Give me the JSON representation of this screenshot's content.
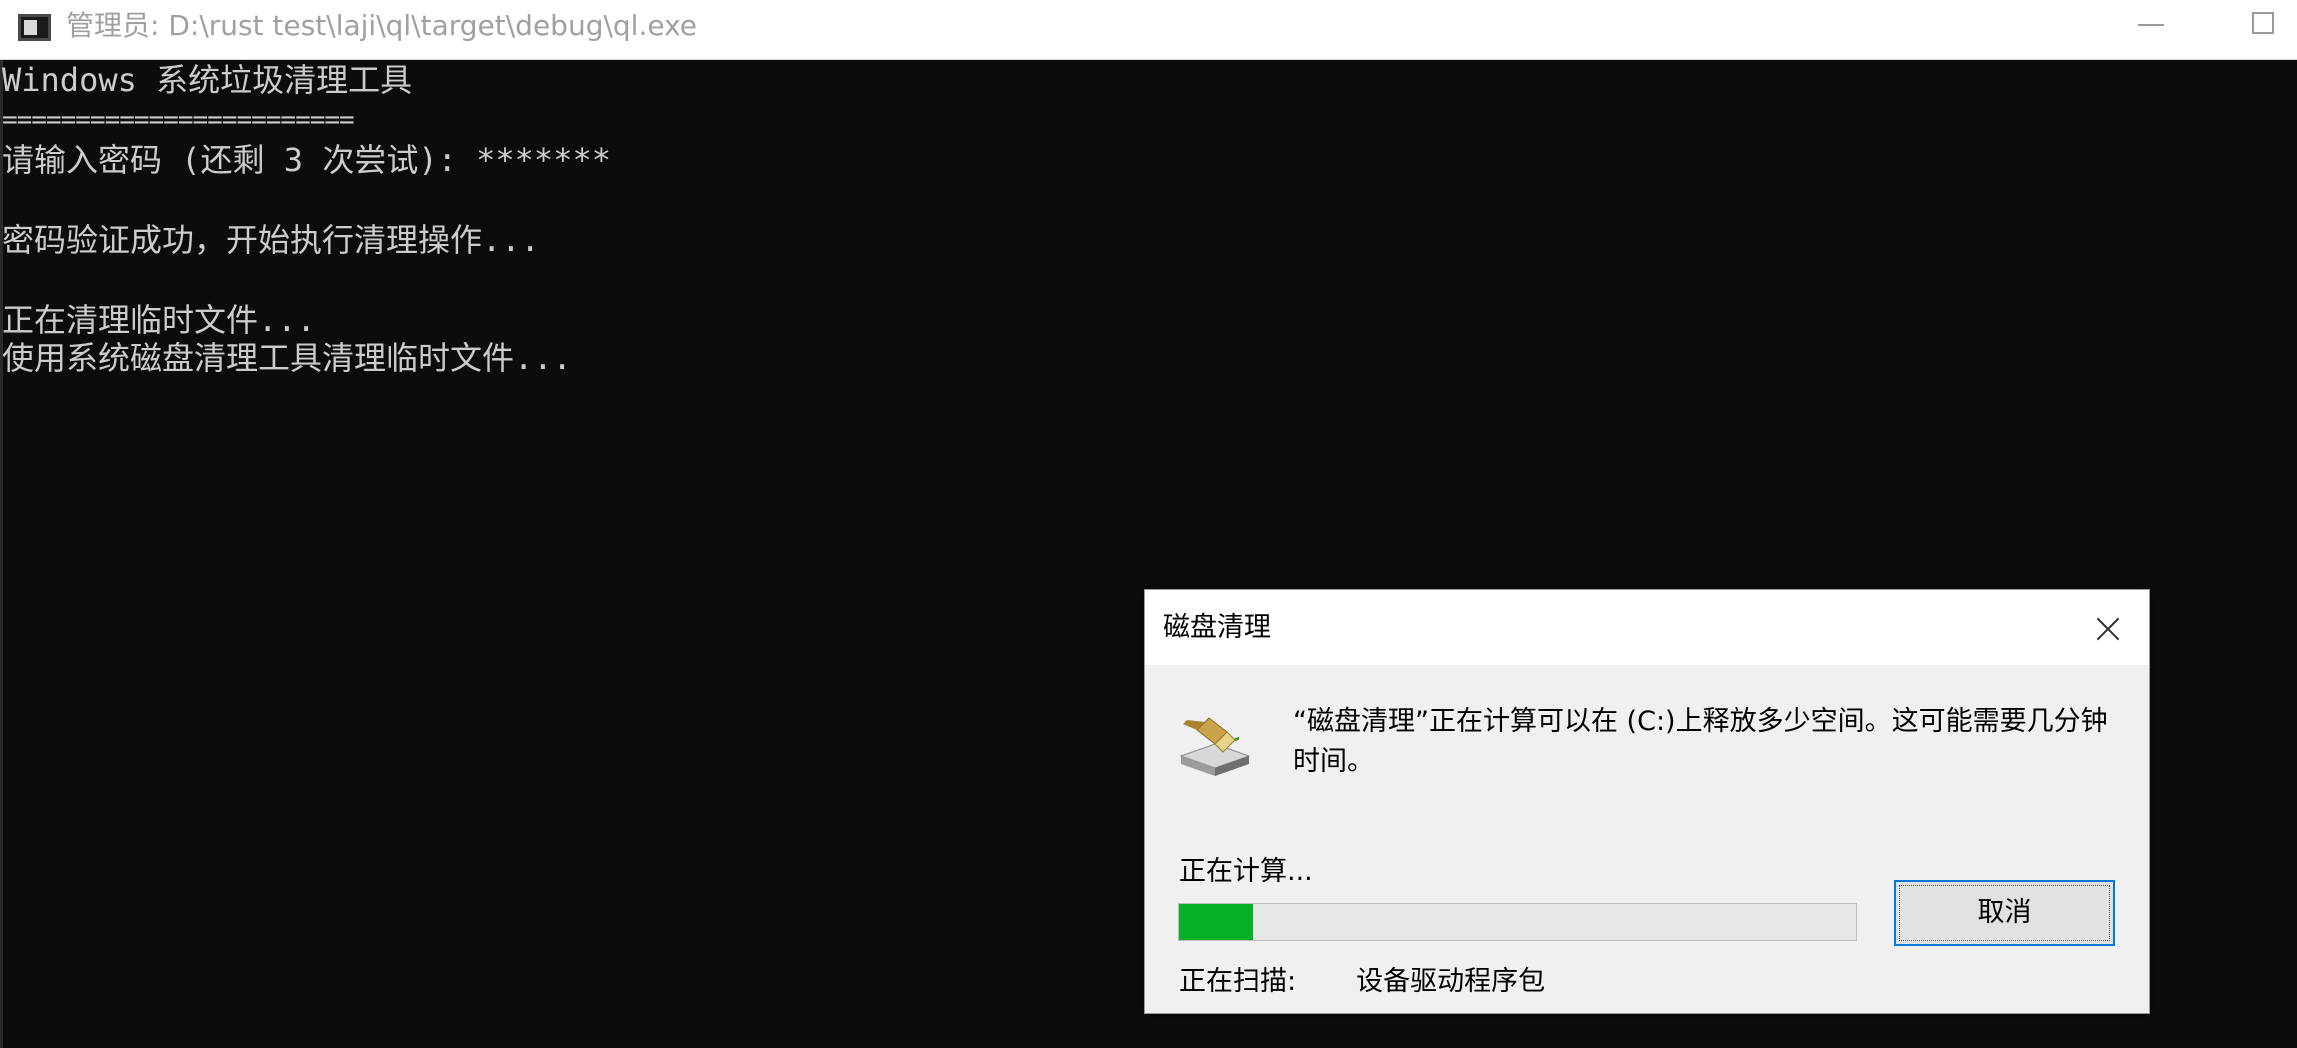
{
  "window": {
    "title": "管理员: D:\\rust test\\laji\\ql\\target\\debug\\ql.exe"
  },
  "console": {
    "lines": [
      "Windows 系统垃圾清理工具",
      "========================",
      "请输入密码 (还剩 3 次尝试): *******",
      "密码验证成功，开始执行清理操作...",
      "正在清理临时文件...",
      "使用系统磁盘清理工具清理临时文件..."
    ]
  },
  "dialog": {
    "title": "磁盘清理",
    "message": "“磁盘清理”正在计算可以在 (C:)上释放多少空间。这可能需要几分钟时间。",
    "status_label": "正在计算...",
    "progress_fraction": 0.11,
    "progress_color": "#06b025",
    "cancel_label": "取消",
    "scan_label": "正在扫描:",
    "scan_value": "设备驱动程序包"
  },
  "icons": {
    "app": "console-window-icon",
    "dialog": "disk-cleanup-icon"
  }
}
